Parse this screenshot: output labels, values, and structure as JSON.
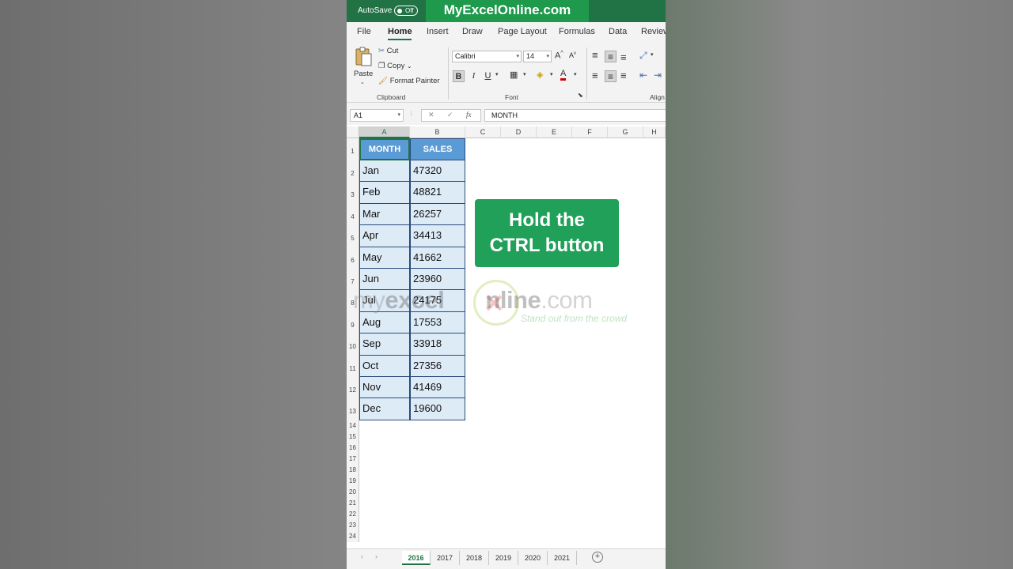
{
  "titlebar": {
    "autosave_label": "AutoSave",
    "autosave_state": "Off",
    "brand": "MyExcelOnline.com"
  },
  "tabs": [
    "File",
    "Home",
    "Insert",
    "Draw",
    "Page Layout",
    "Formulas",
    "Data",
    "Review"
  ],
  "active_tab": "Home",
  "ribbon": {
    "paste": "Paste",
    "cut": "Cut",
    "copy": "Copy",
    "format_painter": "Format Painter",
    "clipboard_label": "Clipboard",
    "font_name": "Calibri",
    "font_size": "14",
    "font_label": "Font",
    "align_label": "Align",
    "bold": "B",
    "italic": "I",
    "underline": "U",
    "grow": "A",
    "shrink": "A",
    "font_color": "A"
  },
  "formula_bar": {
    "name_box": "A1",
    "fx": "fx",
    "value": "MONTH"
  },
  "columns": [
    "A",
    "B",
    "C",
    "D",
    "E",
    "F",
    "G",
    "H"
  ],
  "rows": [
    "1",
    "2",
    "3",
    "4",
    "5",
    "6",
    "7",
    "8",
    "9",
    "10",
    "11",
    "12",
    "13",
    "14",
    "15",
    "16",
    "17",
    "18",
    "19",
    "20",
    "21",
    "22",
    "23",
    "24"
  ],
  "table": {
    "headers": [
      "MONTH",
      "SALES"
    ],
    "months": [
      "Jan",
      "Feb",
      "Mar",
      "Apr",
      "May",
      "Jun",
      "Jul",
      "Aug",
      "Sep",
      "Oct",
      "Nov",
      "Dec"
    ],
    "sales": [
      "47320",
      "48821",
      "26257",
      "34413",
      "41662",
      "23960",
      "24175",
      "17553",
      "33918",
      "27356",
      "41469",
      "19600"
    ]
  },
  "callout": {
    "line1": "Hold the",
    "line2": "CTRL button"
  },
  "watermark": {
    "text_a": "my",
    "text_b": "excel",
    "text_c": "nline",
    "text_d": ".com",
    "tagline": "Stand out from the crowd"
  },
  "sheets": [
    "2016",
    "2017",
    "2018",
    "2019",
    "2020",
    "2021"
  ],
  "active_sheet": "2016",
  "colors": {
    "excel_green": "#217346",
    "brand_green": "#1f9a4d",
    "callout_green": "#21a05a",
    "header_blue": "#5b9bd5",
    "cell_blue": "#ddebf7"
  }
}
